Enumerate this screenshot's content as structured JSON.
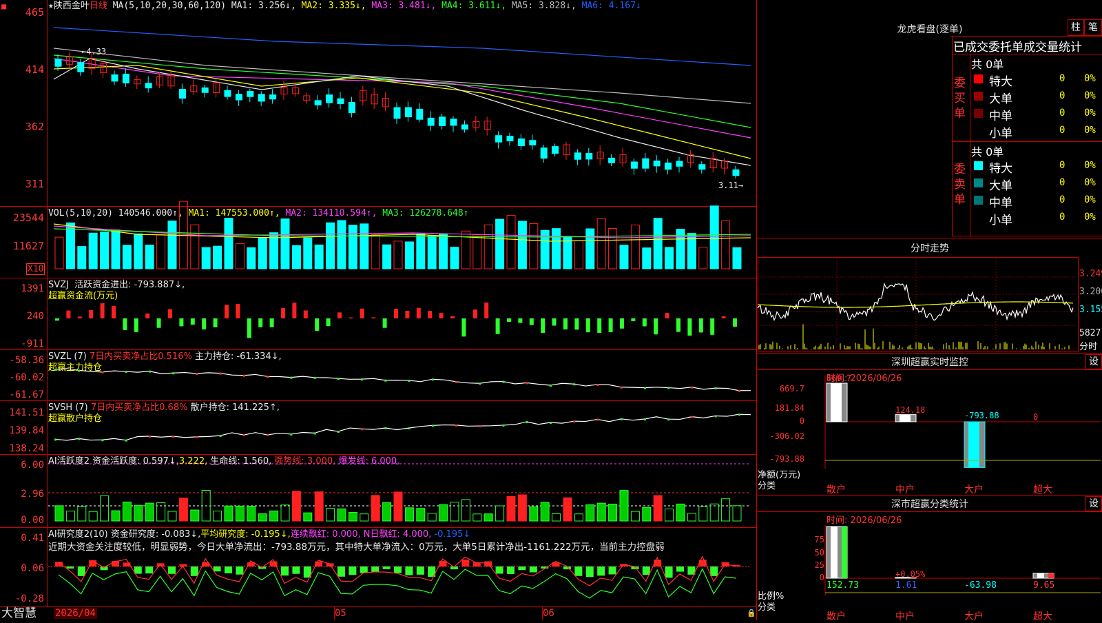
{
  "app": {
    "logo": "大智慧",
    "date_label": "2026/04"
  },
  "main_chart": {
    "title_star": "★",
    "stock_name": "陕西金叶",
    "period": "日线",
    "ma_param": "MA(5,10,20,30,60,120)",
    "ma1": "MA1: 3.256↓,",
    "ma2": "MA2: 3.335↓,",
    "ma3": "MA3: 3.481↓,",
    "ma4": "MA4: 3.611↓,",
    "ma5": "MA5: 3.828↓,",
    "ma6": "MA6: 4.167↓",
    "y_ticks": [
      "465",
      "414",
      "362",
      "311"
    ],
    "high_label": "4.33",
    "low_label": "3.11",
    "colors": {
      "up": "#ff2020",
      "down": "#00ffff"
    }
  },
  "vol": {
    "legend_name": "VOL(5,10,20)",
    "value": "140546.000↑,",
    "ma1": "MA1: 147553.000↑,",
    "ma2": "MA2: 134110.594↑,",
    "ma3": "MA3: 126278.648↑",
    "y_ticks": [
      "23544",
      "11627"
    ],
    "unit": "X10"
  },
  "svzj": {
    "name": "SVZJ",
    "line1": "活跃资金进出: -793.887↓,",
    "subtitle": "超赢资金流(万元)",
    "y_ticks": [
      "1391",
      "240",
      "-911"
    ]
  },
  "svzl": {
    "name": "SVZL (7)",
    "ratio": "7日内买卖净占比0.516%",
    "hold": "主力持仓: -61.334↓,",
    "subtitle": "超赢主力持仓",
    "y_ticks": [
      "-58.36",
      "-60.02",
      "-61.67"
    ]
  },
  "svsh": {
    "name": "SVSH (7)",
    "ratio": "7日内买卖净占比0.68%",
    "hold": "散户持仓: 141.225↑,",
    "subtitle": "超赢散户持仓",
    "y_ticks": [
      "141.51",
      "139.84",
      "138.24"
    ]
  },
  "ai_active": {
    "name": "AI活跃度2",
    "active": "资金活跃度: 0.597↓,",
    "v2": "3.222,",
    "life": "生命线: 1.560,",
    "strong": "强势线: 3.000,",
    "burst": "爆发线: 6.000,",
    "y_ticks": [
      "6.00",
      "2.96",
      "0.00"
    ]
  },
  "ai_research": {
    "name": "AI研究度2(10)",
    "research": "资金研究度: -0.083↓,",
    "avg": "平均研究度: -0.195↓,",
    "cont": "连续飘红: 0.000,",
    "nday": "N日飘红: 4.000,",
    "last": "-0.195↓",
    "comment": "近期大资金关注度较低，明显弱势，今日大单净流出：-793.88万元，其中特大单净流入：0万元，大单5日累计净出-1161.222万元，当前主力控盘弱",
    "y_ticks": [
      "0.41",
      "0.06",
      "-0.28"
    ]
  },
  "x_axis": {
    "labels": [
      "2026/04",
      "05",
      "06"
    ]
  },
  "right": {
    "dragon_title": "龙虎看盘(逐单)",
    "btn_zhu": "柱",
    "btn_bi": "笔",
    "order_header": "已成交委托单成交量统计",
    "buy_label": "委买单",
    "sell_label": "委卖单",
    "buy_total": "共 0单",
    "sell_total": "共 0单",
    "buy_rows": [
      {
        "name": "特大",
        "count": "0",
        "pct": "0%",
        "color": "#ff0000"
      },
      {
        "name": "大单",
        "count": "0",
        "pct": "0%",
        "color": "#990000"
      },
      {
        "name": "中单",
        "count": "0",
        "pct": "0%",
        "color": "#770000"
      },
      {
        "name": "小单",
        "count": "0",
        "pct": "0%",
        "color": "#000000"
      }
    ],
    "sell_rows": [
      {
        "name": "特大",
        "count": "0",
        "pct": "0%",
        "color": "#00ffff"
      },
      {
        "name": "大单",
        "count": "0",
        "pct": "0%",
        "color": "#008888"
      },
      {
        "name": "中单",
        "count": "0",
        "pct": "0%",
        "color": "#007777"
      },
      {
        "name": "小单",
        "count": "0",
        "pct": "0%",
        "color": "#000000"
      }
    ],
    "intraday_title": "分时走势",
    "intraday_ticks": [
      "3.249",
      "3.200",
      "3.155",
      "5827",
      "分时"
    ],
    "monitor_title": "深圳超赢实时监控",
    "monitor_btn": "设",
    "monitor_time": "时间: 2026/06/26",
    "monitor_yticks": [
      "669.7",
      "181.84",
      "0",
      "-306.02",
      "-793.88"
    ],
    "monitor_bars": [
      {
        "cat": "散户",
        "value": 669.7,
        "label": "669.7"
      },
      {
        "cat": "中户",
        "value": 124.18,
        "label": "124.18"
      },
      {
        "cat": "大户",
        "value": -793.88,
        "label": "-793.88"
      },
      {
        "cat": "超大",
        "value": 0,
        "label": "0"
      }
    ],
    "monitor_unit": "净额(万元)",
    "monitor_cat_label": "分类",
    "stat_title": "深市超赢分类统计",
    "stat_btn": "设",
    "stat_time": "时间: 2026/06/26",
    "stat_yticks": [
      "75",
      "50",
      "25",
      "0"
    ],
    "stat_bars": [
      {
        "cat": "散户",
        "value": 152.73,
        "label": "152.73",
        "color": "#2cff2c"
      },
      {
        "cat": "中户",
        "value": 1.61,
        "label": "1.61",
        "color": "#4060ff"
      },
      {
        "cat": "大户",
        "value": -63.98,
        "label": "-63.98",
        "color": "#00ffff"
      },
      {
        "cat": "超大",
        "value": 9.65,
        "label": "9.65",
        "color": "#ff4040"
      }
    ],
    "stat_mid_label": "+0.05%",
    "stat_unit": "比例%",
    "stat_cat_label": "分类"
  }
}
